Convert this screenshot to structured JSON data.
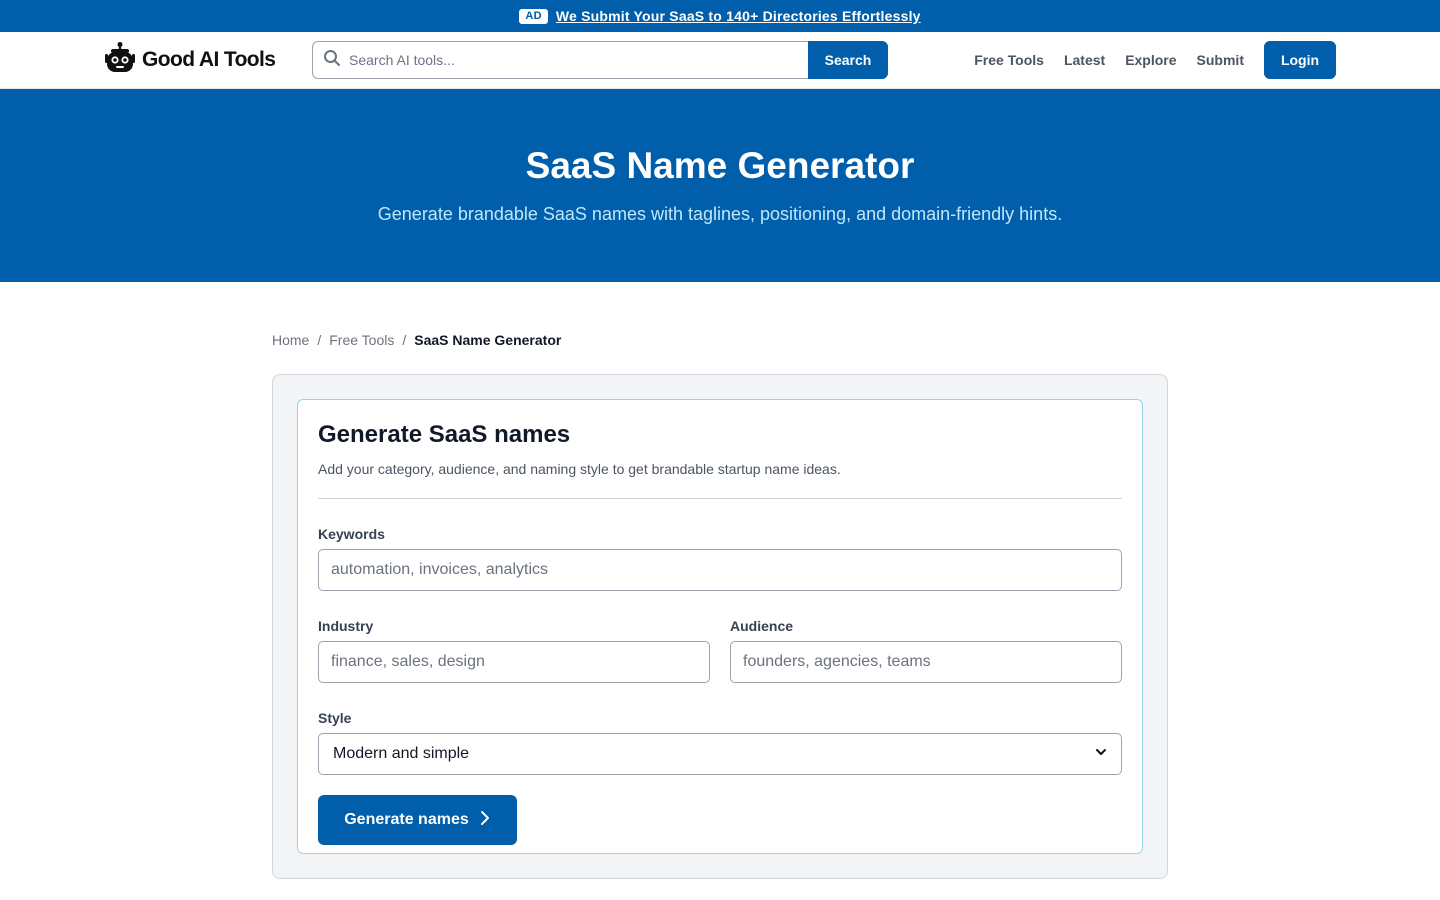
{
  "ad": {
    "badge": "AD",
    "link_text": "We Submit Your SaaS to 140+ Directories Effortlessly"
  },
  "header": {
    "logo_text": "Good AI Tools",
    "search_placeholder": "Search AI tools...",
    "search_button": "Search",
    "nav": [
      "Free Tools",
      "Latest",
      "Explore",
      "Submit"
    ],
    "login_button": "Login"
  },
  "hero": {
    "title": "SaaS Name Generator",
    "subtitle": "Generate brandable SaaS names with taglines, positioning, and domain-friendly hints."
  },
  "breadcrumb": {
    "home": "Home",
    "separator": "/",
    "free_tools": "Free Tools",
    "current": "SaaS Name Generator"
  },
  "form": {
    "title": "Generate SaaS names",
    "description": "Add your category, audience, and naming style to get brandable startup name ideas.",
    "keywords_label": "Keywords",
    "keywords_placeholder": "automation, invoices, analytics",
    "industry_label": "Industry",
    "industry_placeholder": "finance, sales, design",
    "audience_label": "Audience",
    "audience_placeholder": "founders, agencies, teams",
    "style_label": "Style",
    "style_selected": "Modern and simple",
    "generate_button": "Generate names"
  },
  "colors": {
    "brand_blue": "#005eaa",
    "hero_subtitle": "#bfe7fb",
    "card_border": "#93d5ec",
    "panel_bg": "#f3f4f6"
  },
  "icons": {
    "logo": "robot-icon",
    "search": "search-icon",
    "select_caret": "chevron-down-icon",
    "button_arrow": "chevron-right-icon"
  }
}
